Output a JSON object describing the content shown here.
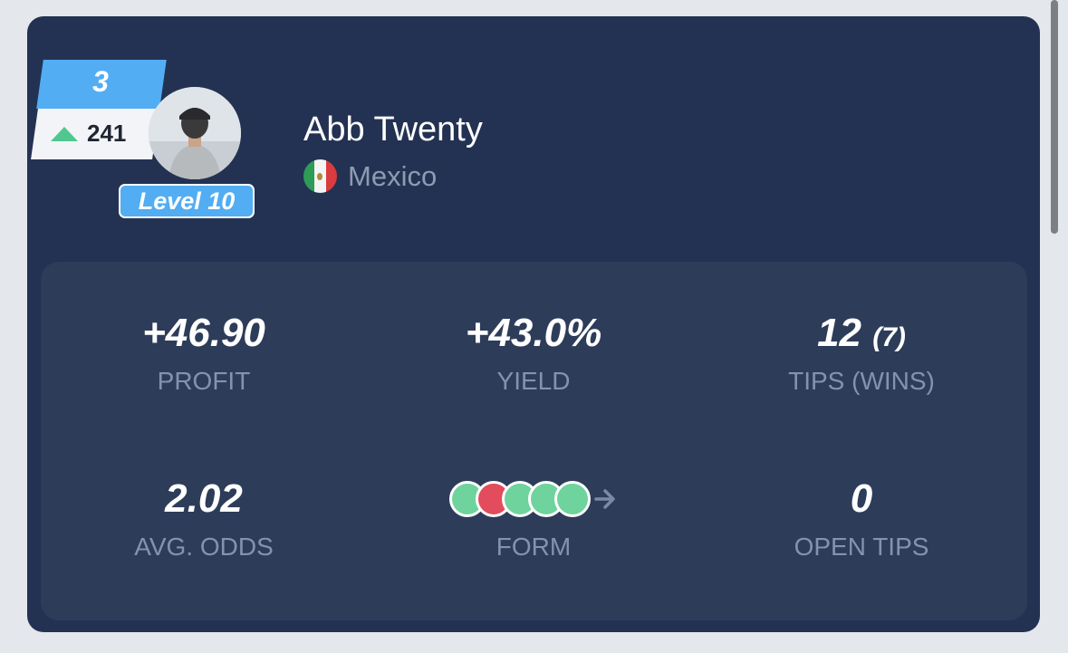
{
  "profile": {
    "rank": "3",
    "rank_change": "241",
    "level": "Level 10",
    "name": "Abb Twenty",
    "country": "Mexico"
  },
  "stats": {
    "profit": {
      "value": "+46.90",
      "label": "PROFIT"
    },
    "yield": {
      "value": "+43.0%",
      "label": "YIELD"
    },
    "tips": {
      "value": "12",
      "wins": "(7)",
      "label": "TIPS (WINS)"
    },
    "avg_odds": {
      "value": "2.02",
      "label": "AVG. ODDS"
    },
    "form": {
      "label": "FORM",
      "results": [
        "win",
        "loss",
        "win",
        "win",
        "win"
      ]
    },
    "open_tips": {
      "value": "0",
      "label": "OPEN TIPS"
    }
  },
  "colors": {
    "card": "#233252",
    "stats_panel": "#2d3c59",
    "accent_blue": "#52adf3",
    "win": "#6fd39d",
    "loss": "#e24c5c"
  },
  "icons": {
    "rank_change": "triangle-up-icon",
    "form_arrow": "arrow-right-icon",
    "flag": "mexico-flag-icon"
  }
}
